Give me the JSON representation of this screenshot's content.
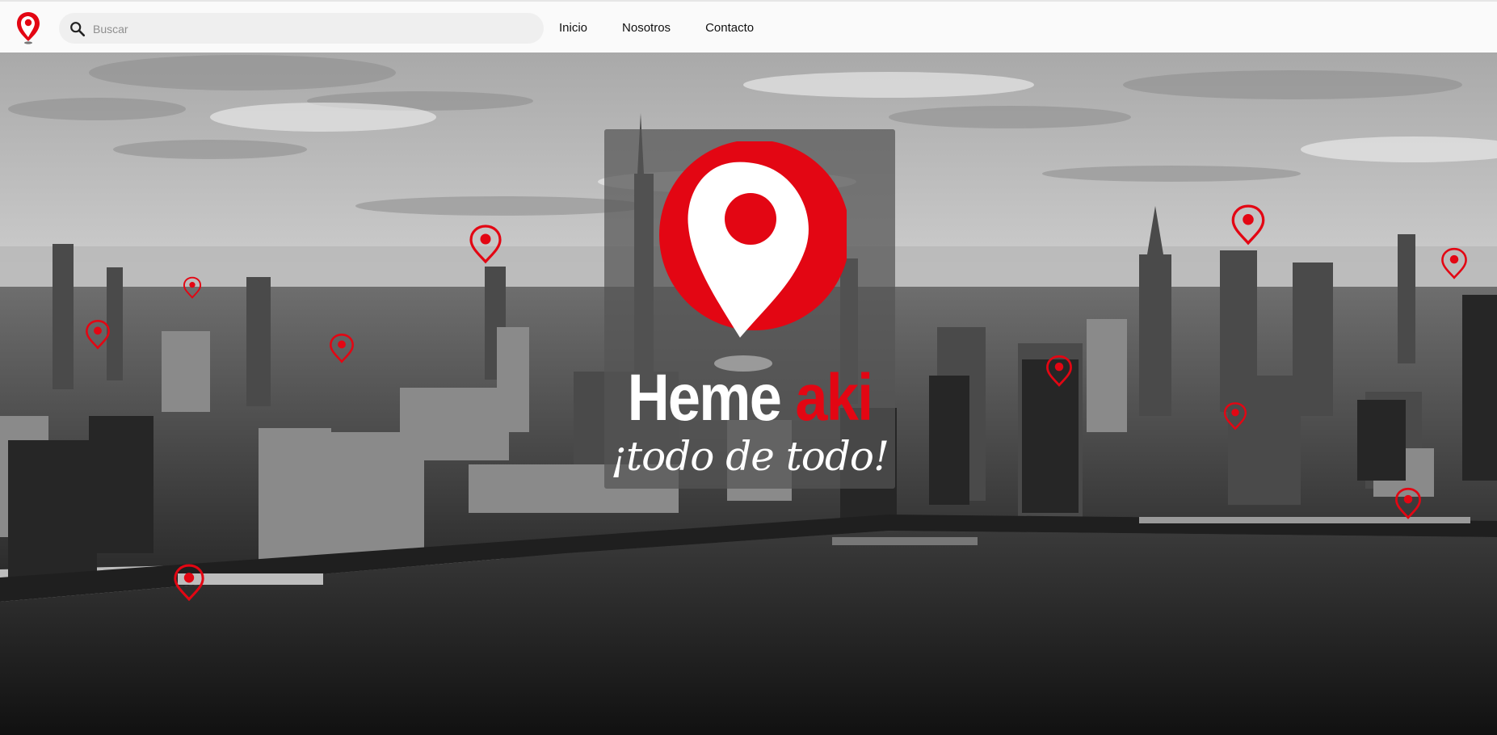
{
  "header": {
    "logo_icon": "location-pin-icon",
    "search": {
      "placeholder": "Buscar",
      "value": "",
      "icon": "search-icon"
    },
    "nav": [
      {
        "label": "Inicio"
      },
      {
        "label": "Nosotros"
      },
      {
        "label": "Contacto"
      }
    ]
  },
  "hero": {
    "background": "black-and-white city skyline photo",
    "logo": {
      "name_part1": "Heme ",
      "name_part2": "aki",
      "tagline": "¡todo de todo!"
    },
    "pin_icon": "location-pin-icon"
  },
  "colors": {
    "brand_red": "#e30613",
    "white": "#ffffff",
    "topbar_bg": "#fafafa",
    "search_bg": "#efefef"
  }
}
